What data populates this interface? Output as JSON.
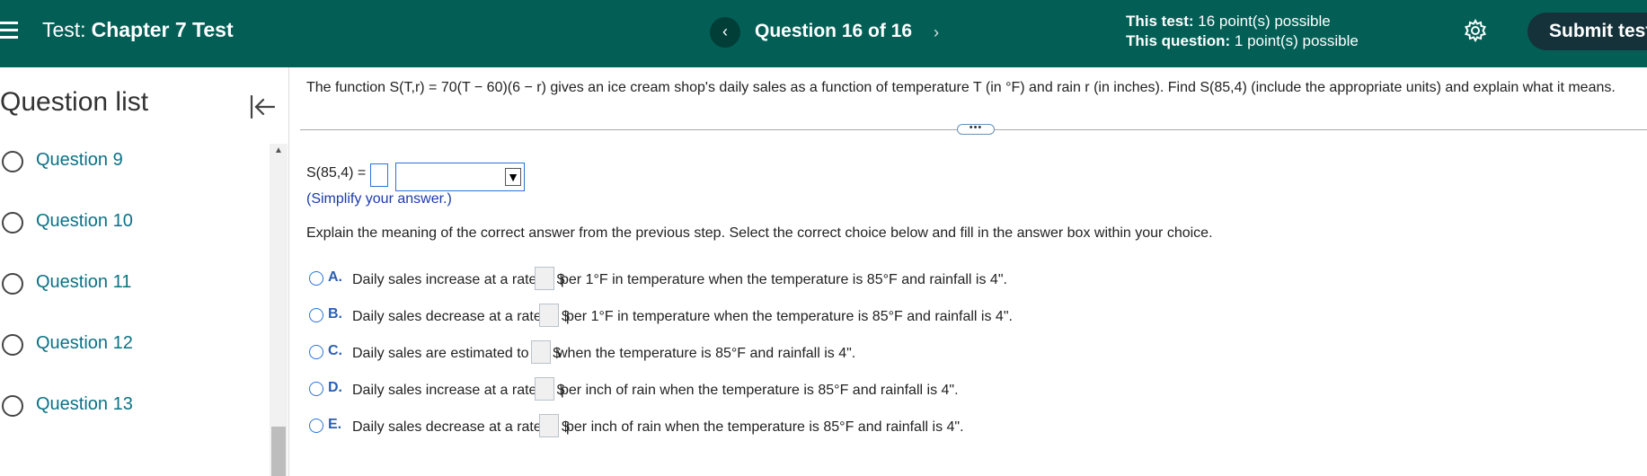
{
  "header": {
    "test_prefix": "Test:",
    "test_name": "Chapter 7 Test",
    "prev_label": "‹",
    "counter": "Question 16 of 16",
    "next_label": "›",
    "this_test_label": "This test:",
    "this_test_value": "16 point(s) possible",
    "this_question_label": "This question:",
    "this_question_value": "1 point(s) possible",
    "submit_label": "Submit test",
    "colors": {
      "bar": "#035f56",
      "submit": "#15313a"
    }
  },
  "sidebar": {
    "title": "Question list",
    "items": [
      {
        "label": "Question 9"
      },
      {
        "label": "Question 10"
      },
      {
        "label": "Question 11"
      },
      {
        "label": "Question 12"
      },
      {
        "label": "Question 13"
      }
    ]
  },
  "question": {
    "text": "The function S(T,r) = 70(T − 60)(6 − r) gives an ice cream shop's daily sales as a function of temperature T (in °F) and rain r (in inches). Find S(85,4) (include the appropriate units) and explain what it means.",
    "answer_label": "S(85,4) =",
    "answer_value": "",
    "unit_selected": "",
    "hint": "(Simplify your answer.)",
    "explain": "Explain the meaning of the correct answer from the previous step. Select the correct choice below and fill in the answer box within your choice.",
    "choices": [
      {
        "letter": "A.",
        "pre": "Daily sales increase at a rate of $",
        "post": "per 1°F in temperature when the temperature is 85°F and rainfall is 4\"."
      },
      {
        "letter": "B.",
        "pre": "Daily sales decrease at a rate of $",
        "post": "per 1°F in temperature when the temperature is 85°F and rainfall is 4\"."
      },
      {
        "letter": "C.",
        "pre": "Daily sales are estimated to be $",
        "post": "when the temperature is 85°F and rainfall is 4\"."
      },
      {
        "letter": "D.",
        "pre": "Daily sales increase at a rate of $",
        "post": "per inch of rain when the temperature is 85°F and rainfall is 4\"."
      },
      {
        "letter": "E.",
        "pre": "Daily sales decrease at a rate of $",
        "post": "per inch of rain when the temperature is 85°F and rainfall is 4\"."
      }
    ]
  }
}
